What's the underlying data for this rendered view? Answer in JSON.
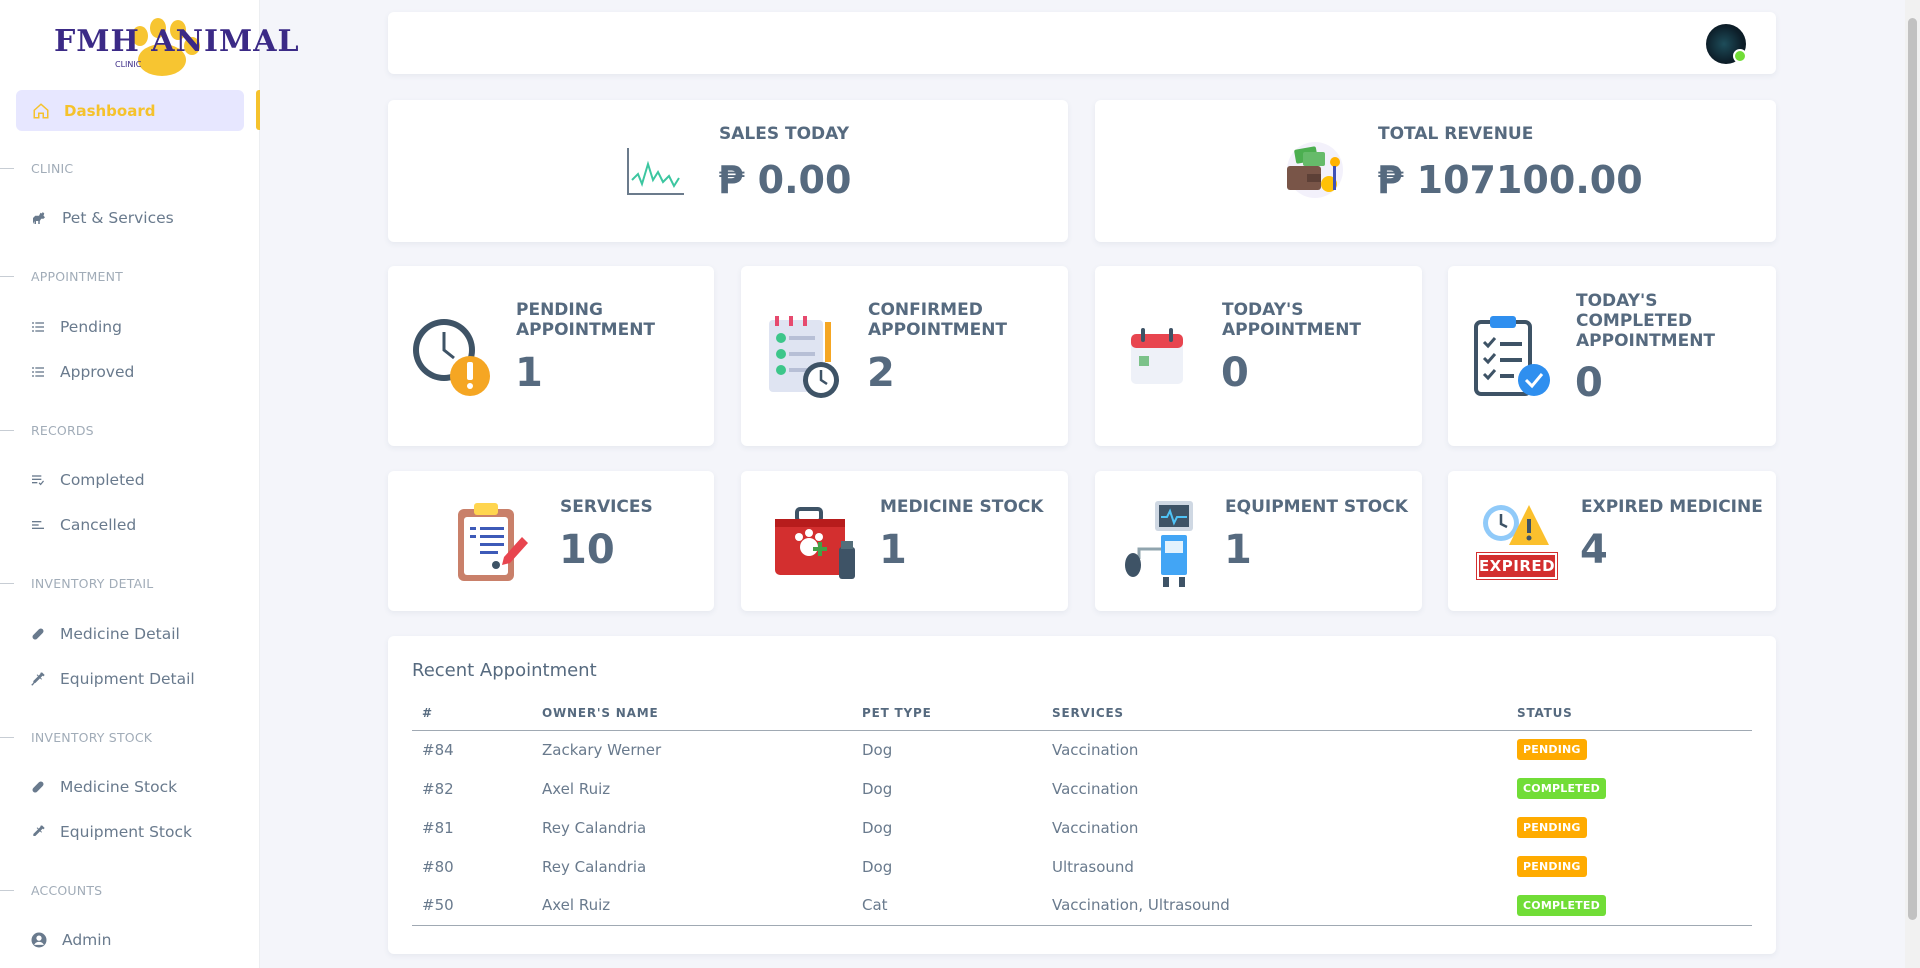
{
  "brand": {
    "name": "FMH ANIMAL",
    "sub": "CLINIC"
  },
  "colors": {
    "accent": "#f5c22c",
    "pending": "#ffab00",
    "completed": "#71dd37",
    "text": "#566a7f"
  },
  "sidebar": {
    "active": {
      "label": "Dashboard",
      "icon": "home-icon"
    },
    "sections": [
      {
        "header": "CLINIC",
        "items": [
          {
            "label": "Pet & Services",
            "icon": "dog-icon"
          }
        ]
      },
      {
        "header": "APPOINTMENT",
        "items": [
          {
            "label": "Pending",
            "icon": "list-icon"
          },
          {
            "label": "Approved",
            "icon": "list-icon"
          }
        ]
      },
      {
        "header": "RECORDS",
        "items": [
          {
            "label": "Completed",
            "icon": "checklist-icon"
          },
          {
            "label": "Cancelled",
            "icon": "lines-icon"
          }
        ]
      },
      {
        "header": "INVENTORY DETAIL",
        "items": [
          {
            "label": "Medicine Detail",
            "icon": "pill-icon"
          },
          {
            "label": "Equipment Detail",
            "icon": "syringe-icon"
          }
        ]
      },
      {
        "header": "INVENTORY STOCK",
        "items": [
          {
            "label": "Medicine Stock",
            "icon": "pill-icon"
          },
          {
            "label": "Equipment Stock",
            "icon": "syringe-icon"
          }
        ]
      },
      {
        "header": "ACCOUNTS",
        "items": [
          {
            "label": "Admin",
            "icon": "user-circle-icon"
          }
        ]
      }
    ]
  },
  "stats": {
    "sales_today": {
      "title": "SALES TODAY",
      "value": "₱ 0.00",
      "icon": "line-chart-icon"
    },
    "total_revenue": {
      "title": "TOTAL REVENUE",
      "value": "₱ 107100.00",
      "icon": "money-wallet-icon"
    },
    "pending": {
      "title": "PENDING\nAPPOINTMENT",
      "value": "1",
      "icon": "clock-alert-icon"
    },
    "confirmed": {
      "title": "CONFIRMED\nAPPOINTMENT",
      "value": "2",
      "icon": "checklist-clock-icon"
    },
    "today": {
      "title": "TODAY'S\nAPPOINTMENT",
      "value": "0",
      "icon": "calendar-icon"
    },
    "today_completed": {
      "title": "TODAY'S\nCOMPLETED\nAPPOINTMENT",
      "value": "0",
      "icon": "clipboard-check-icon"
    },
    "services": {
      "title": "SERVICES",
      "value": "10",
      "icon": "clipboard-paw-icon"
    },
    "medicine_stock": {
      "title": "MEDICINE STOCK",
      "value": "1",
      "icon": "vet-kit-icon"
    },
    "equipment_stock": {
      "title": "EQUIPMENT STOCK",
      "value": "1",
      "icon": "medical-machine-icon"
    },
    "expired_medicine": {
      "title": "EXPIRED MEDICINE",
      "value": "4",
      "icon": "expired-icon",
      "badge_text": "EXPIRED"
    }
  },
  "recent": {
    "title": "Recent Appointment",
    "columns": [
      "#",
      "OWNER'S NAME",
      "PET TYPE",
      "SERVICES",
      "STATUS"
    ],
    "rows": [
      {
        "id": "#84",
        "owner": "Zackary Werner",
        "pet": "Dog",
        "services": "Vaccination",
        "status": "PENDING"
      },
      {
        "id": "#82",
        "owner": "Axel Ruiz",
        "pet": "Dog",
        "services": "Vaccination",
        "status": "COMPLETED"
      },
      {
        "id": "#81",
        "owner": "Rey Calandria",
        "pet": "Dog",
        "services": "Vaccination",
        "status": "PENDING"
      },
      {
        "id": "#80",
        "owner": "Rey Calandria",
        "pet": "Dog",
        "services": "Ultrasound",
        "status": "PENDING"
      },
      {
        "id": "#50",
        "owner": "Axel Ruiz",
        "pet": "Cat",
        "services": "Vaccination, Ultrasound",
        "status": "COMPLETED"
      }
    ]
  }
}
